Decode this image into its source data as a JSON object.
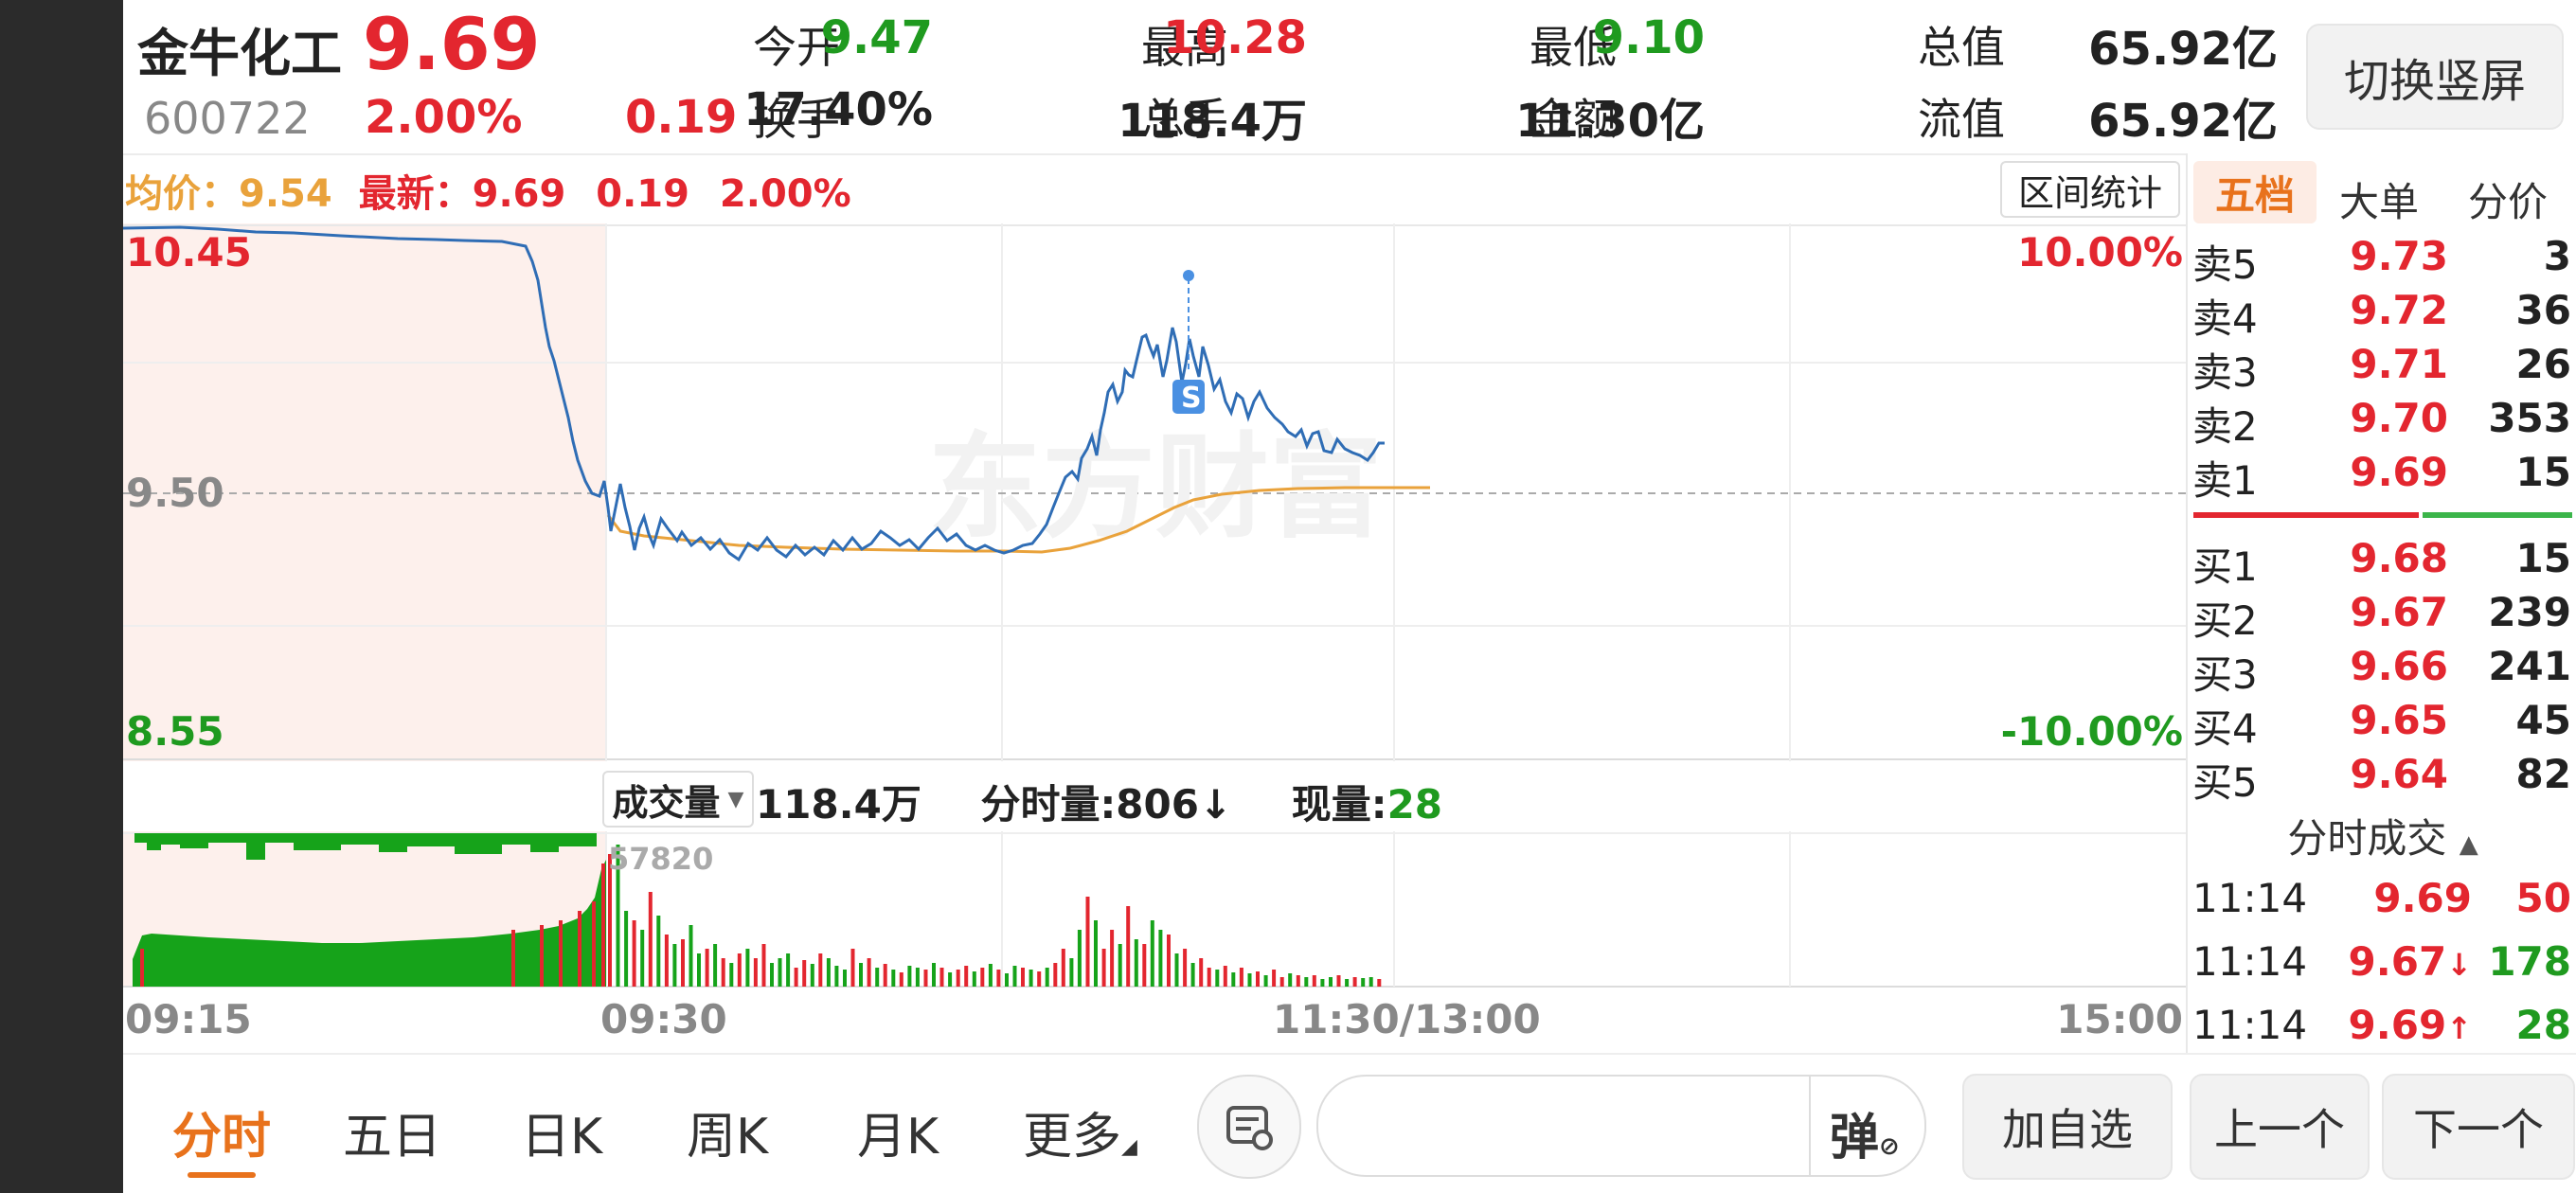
{
  "header": {
    "name": "金牛化工",
    "price": "9.69",
    "code": "600722",
    "change_pct": "2.00%",
    "change": "0.19",
    "stats": [
      {
        "label": "今开",
        "value": "9.47",
        "color": "green"
      },
      {
        "label": "最高",
        "value": "10.28",
        "color": "red"
      },
      {
        "label": "最低",
        "value": "9.10",
        "color": "green"
      },
      {
        "label": "总值",
        "value": "65.92亿",
        "color": "dark"
      },
      {
        "label": "换手",
        "value": "17.40%",
        "color": "dark"
      },
      {
        "label": "总手",
        "value": "118.4万",
        "color": "dark"
      },
      {
        "label": "金额",
        "value": "11.30亿",
        "color": "dark"
      },
      {
        "label": "流值",
        "value": "65.92亿",
        "color": "dark"
      }
    ],
    "switch_label": "切换竖屏"
  },
  "chart_info": {
    "avg_label": "均价：",
    "avg_value": "9.54",
    "latest_label": "最新：",
    "latest_value": "9.69",
    "latest_change": "0.19",
    "latest_pct": "2.00%",
    "interval_btn": "区间统计",
    "y_top": "10.45",
    "y_mid": "9.50",
    "y_bottom": "8.55",
    "pct_top": "10.00%",
    "pct_bottom": "-10.00%",
    "watermark": "东方财富",
    "signal": "S"
  },
  "volume_info": {
    "selector": "成交量",
    "total": "118.4万",
    "minute_label": "分时量:",
    "minute_value": "806",
    "current_label": "现量:",
    "current_value": "28",
    "peak_label": "57820"
  },
  "time_axis": [
    "09:15",
    "09:30",
    "11:30/13:00",
    "15:00"
  ],
  "order_book": {
    "tabs": [
      "五档",
      "大单",
      "分价"
    ],
    "asks": [
      {
        "label": "卖5",
        "price": "9.73",
        "vol": "3"
      },
      {
        "label": "卖4",
        "price": "9.72",
        "vol": "36"
      },
      {
        "label": "卖3",
        "price": "9.71",
        "vol": "26"
      },
      {
        "label": "卖2",
        "price": "9.70",
        "vol": "353"
      },
      {
        "label": "卖1",
        "price": "9.69",
        "vol": "15"
      }
    ],
    "bids": [
      {
        "label": "买1",
        "price": "9.68",
        "vol": "15"
      },
      {
        "label": "买2",
        "price": "9.67",
        "vol": "239"
      },
      {
        "label": "买3",
        "price": "9.66",
        "vol": "241"
      },
      {
        "label": "买4",
        "price": "9.65",
        "vol": "45"
      },
      {
        "label": "买5",
        "price": "9.64",
        "vol": "82"
      }
    ],
    "trades_title": "分时成交",
    "trades": [
      {
        "time": "11:14",
        "price": "9.69",
        "arrow": "",
        "vol": "50",
        "vol_color": "#e3262f"
      },
      {
        "time": "11:14",
        "price": "9.67",
        "arrow": "↓",
        "vol": "178",
        "vol_color": "#1f9a1f"
      },
      {
        "time": "11:14",
        "price": "9.69",
        "arrow": "↑",
        "vol": "28",
        "vol_color": "#1f9a1f"
      }
    ]
  },
  "bottom_bar": {
    "tabs": [
      "分时",
      "五日",
      "日K",
      "周K",
      "月K",
      "更多"
    ],
    "bullet_btn": "弹",
    "add_btn": "加自选",
    "prev_btn": "上一个",
    "next_btn": "下一个"
  },
  "colors": {
    "up": "#e3262f",
    "down": "#1f9a1f",
    "price_line": "#2f6db5",
    "avg_line": "#e9a23b",
    "active_tab": "#e8721c"
  }
}
